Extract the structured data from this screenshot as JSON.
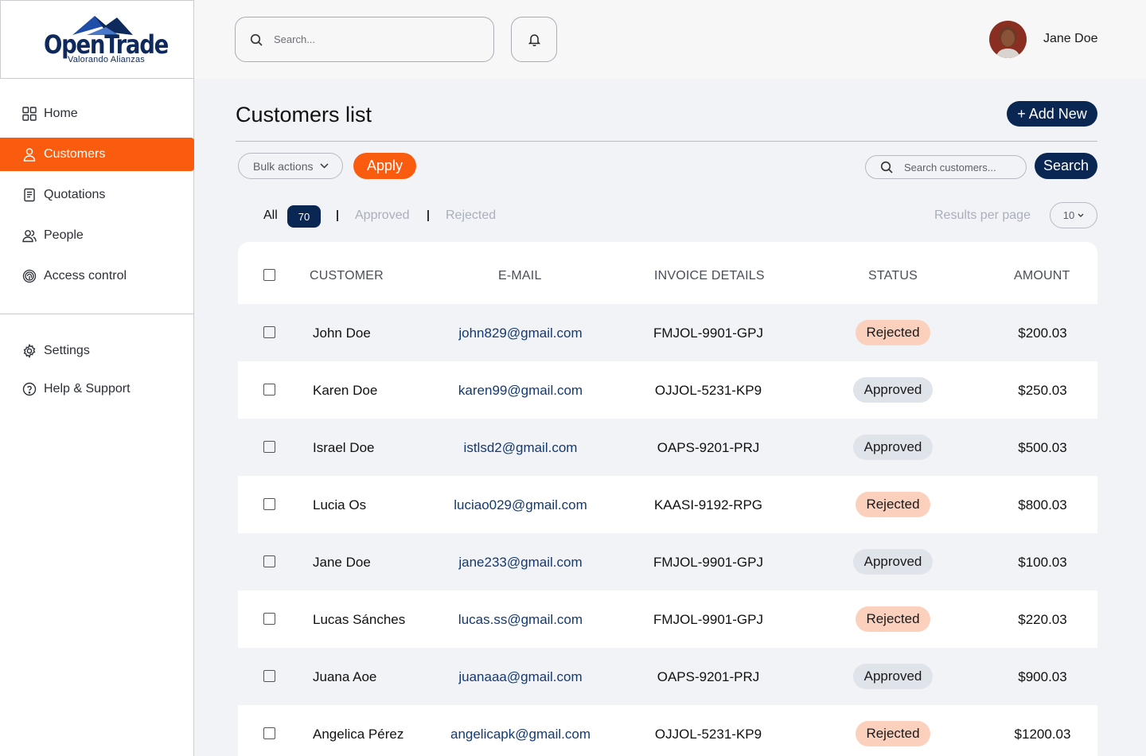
{
  "brand": {
    "name": "OpenTrade",
    "tagline": "Valorando Alianzas",
    "accent": "#f95c0e",
    "navy": "#0a2754"
  },
  "sidebar": {
    "items": [
      {
        "label": "Home",
        "icon": "grid-icon"
      },
      {
        "label": "Customers",
        "icon": "user-icon",
        "active": true
      },
      {
        "label": "Quotations",
        "icon": "document-icon"
      },
      {
        "label": "People",
        "icon": "people-icon"
      },
      {
        "label": "Access control",
        "icon": "fingerprint-icon"
      }
    ],
    "bottom_items": [
      {
        "label": "Settings",
        "icon": "gear-icon"
      },
      {
        "label": "Help & Support",
        "icon": "help-icon"
      }
    ]
  },
  "header": {
    "search_placeholder": "Search...",
    "user_name": "Jane Doe"
  },
  "main": {
    "title": "Customers list",
    "add_new_label": "+ Add New",
    "bulk_actions_label": "Bulk actions",
    "apply_label": "Apply",
    "search_placeholder": "Search customers...",
    "search_button_label": "Search",
    "filters": {
      "all_label": "All",
      "all_count": "70",
      "approved_label": "Approved",
      "rejected_label": "Rejected"
    },
    "results_per_page_label": "Results per page",
    "results_per_page_value": "10"
  },
  "table": {
    "columns": [
      "CUSTOMER",
      "E-MAIL",
      "INVOICE DETAILS",
      "STATUS",
      "AMOUNT"
    ],
    "rows": [
      {
        "customer": "John Doe",
        "email": "john829@gmail.com",
        "invoice": "FMJOL-9901-GPJ",
        "status": "Rejected",
        "amount": "$200.03"
      },
      {
        "customer": "Karen Doe",
        "email": "karen99@gmail.com",
        "invoice": "OJJOL-5231-KP9",
        "status": "Approved",
        "amount": "$250.03"
      },
      {
        "customer": "Israel Doe",
        "email": "istlsd2@gmail.com",
        "invoice": "OAPS-9201-PRJ",
        "status": "Approved",
        "amount": "$500.03"
      },
      {
        "customer": "Lucia Os",
        "email": "luciao029@gmail.com",
        "invoice": "KAASI-9192-RPG",
        "status": "Rejected",
        "amount": "$800.03"
      },
      {
        "customer": "Jane Doe",
        "email": "jane233@gmail.com",
        "invoice": "FMJOL-9901-GPJ",
        "status": "Approved",
        "amount": "$100.03"
      },
      {
        "customer": "Lucas Sánches",
        "email": "lucas.ss@gmail.com",
        "invoice": "FMJOL-9901-GPJ",
        "status": "Rejected",
        "amount": "$220.03"
      },
      {
        "customer": "Juana Aoe",
        "email": "juanaaa@gmail.com",
        "invoice": "OAPS-9201-PRJ",
        "status": "Approved",
        "amount": "$900.03"
      },
      {
        "customer": "Angelica Pérez",
        "email": "angelicapk@gmail.com",
        "invoice": "OJJOL-5231-KP9",
        "status": "Rejected",
        "amount": "$1200.03"
      }
    ]
  }
}
